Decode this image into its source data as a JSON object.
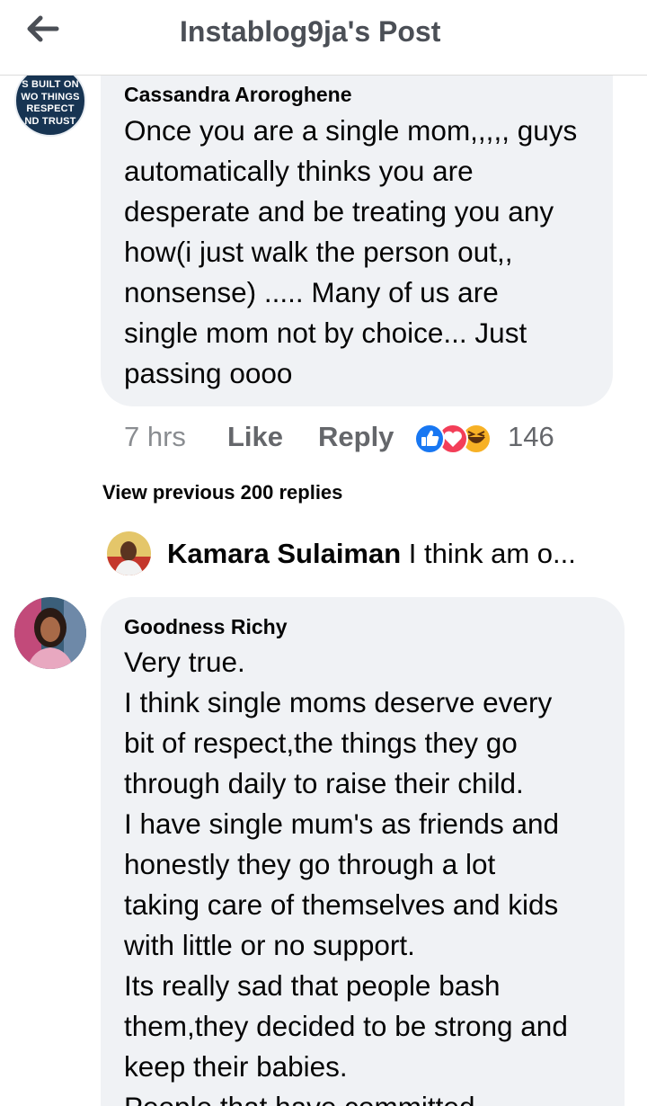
{
  "header": {
    "back_icon": "arrow-left-icon",
    "title": "Instablog9ja's Post"
  },
  "comment1": {
    "avatar_text": "S BUILT ON\nWO THINGS\nRESPECT\nND TRUST",
    "author": "Cassandra Aroroghene",
    "text": "Once you are a single mom,,,,, guys\nautomatically thinks you are\ndesperate and be treating you any\nhow(i just walk the person out,,\nnonsense) ..... Many of us are\nsingle mom not by choice... Just\npassing oooo",
    "time": "7 hrs",
    "like_label": "Like",
    "reply_label": "Reply",
    "reactions": [
      "like-reaction-icon",
      "love-reaction-icon",
      "haha-reaction-icon"
    ],
    "reaction_count": "146",
    "colors": {
      "like": "#1877f2",
      "love": "#f33e58",
      "haha": "#f7b125"
    }
  },
  "replies": {
    "view_previous_label": "View previous 200 replies",
    "latest_reply": {
      "author": "Kamara Sulaiman",
      "preview": "I think am o..."
    }
  },
  "comment2": {
    "author": "Goodness Richy",
    "text": "Very true.\nI think single moms deserve every\nbit of respect,the things they go\nthrough daily to raise their child.\nI have single mum's as friends and\nhonestly they go through a lot\ntaking care of themselves and kids\nwith little or no support.\nIts really sad that people bash\nthem,they decided to be strong and\nkeep their babies.\nPeople that have committed"
  }
}
